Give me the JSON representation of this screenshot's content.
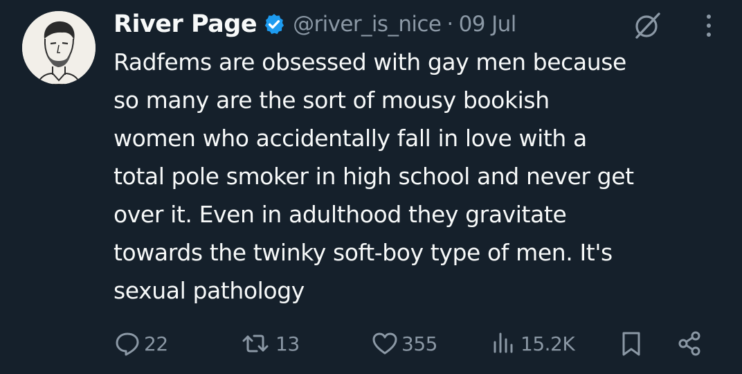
{
  "tweet": {
    "author_name": "River Page",
    "handle": "@river_is_nice",
    "separator": "·",
    "date": "09 Jul",
    "text": "Radfems are obsessed with gay men because\nso many are the sort of mousy bookish\nwomen who accidentally fall in love with a\ntotal pole smoker in high school and never get\nover it. Even in adulthood they gravitate\ntowards the twinky soft-boy type of men. It's\nsexual pathology"
  },
  "actions": {
    "replies": "22",
    "reposts": "13",
    "likes": "355",
    "views": "15.2K"
  },
  "icons": {
    "avatar": "avatar-sketch",
    "verified": "verified-badge-icon",
    "grok": "grok-icon",
    "more": "more-vertical-icon",
    "reply": "reply-icon",
    "retweet": "retweet-icon",
    "like": "heart-icon",
    "views": "views-icon",
    "bookmark": "bookmark-icon",
    "share": "share-icon"
  },
  "colors": {
    "background": "#15202b",
    "text": "#f7f9f9",
    "muted": "#8b98a5",
    "verified": "#1d9bf0"
  }
}
